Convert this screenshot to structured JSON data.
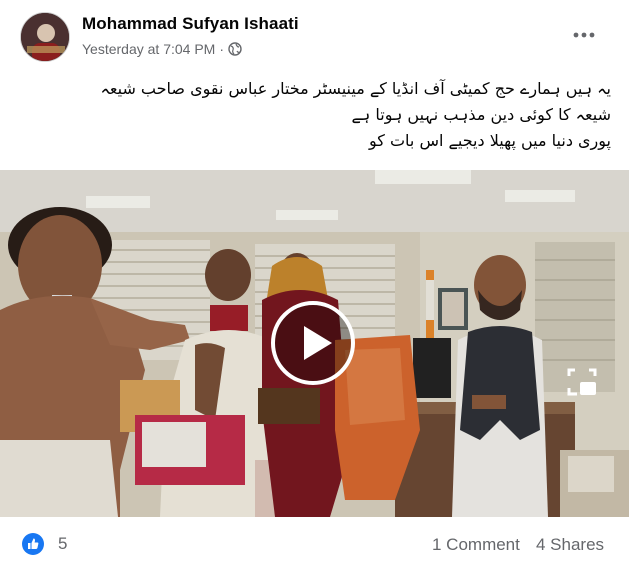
{
  "post": {
    "author": "Mohammad Sufyan Ishaati",
    "timestamp": "Yesterday at 7:04 PM",
    "separator": "·",
    "privacy_icon": "globe-icon",
    "more_icon": "more-horizontal-icon",
    "caption_lines": [
      "یہ ہیں ہمارے حج کمیٹی آف انڈیا کے مینیسٹر  مختار عباس نقوی صاحب  شیعہ",
      "شیعہ کا کوئی دین مذہب نہیں ہوتا ہے",
      "پوری دنیا میں پھیلا دیجیے اس بات کو"
    ]
  },
  "video": {
    "play_icon": "play-icon",
    "pip_icon": "picture-in-picture-icon"
  },
  "footer": {
    "reaction_icon": "like-reaction-icon",
    "like_count": "5",
    "comments": "1 Comment",
    "shares": "4 Shares"
  },
  "colors": {
    "primary_text": "#050505",
    "secondary_text": "#65676b",
    "like_blue": "#1877f2"
  }
}
